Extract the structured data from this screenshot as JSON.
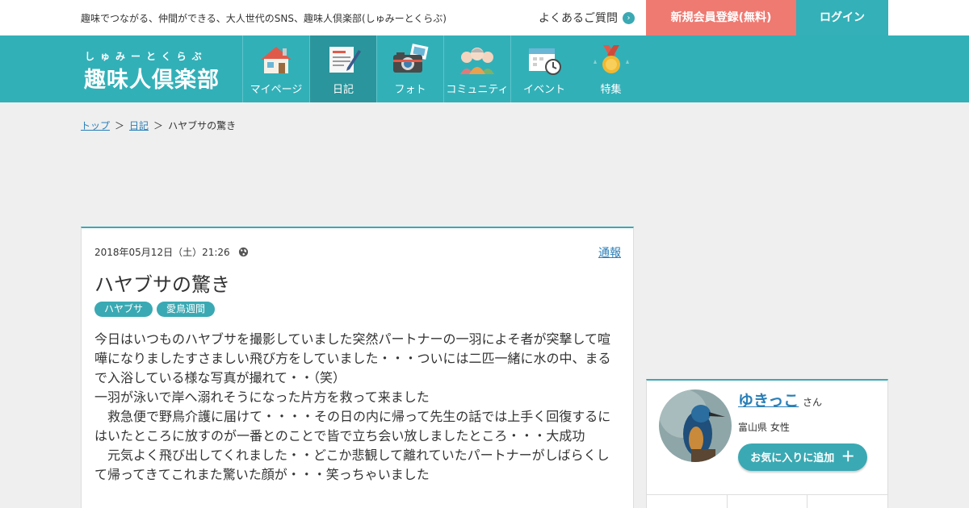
{
  "header": {
    "tagline": "趣味でつながる、仲間ができる、大人世代のSNS、趣味人倶楽部(しゅみーとくらぶ)",
    "faq_label": "よくあるご質問",
    "register_label": "新規会員登録(無料)",
    "login_label": "ログイン"
  },
  "logo": {
    "ruby": "しゅみーとくらぶ",
    "name": "趣味人倶楽部"
  },
  "nav": {
    "items": [
      {
        "label": "マイページ",
        "icon": "house-icon"
      },
      {
        "label": "日記",
        "icon": "diary-icon"
      },
      {
        "label": "フォト",
        "icon": "camera-icon"
      },
      {
        "label": "コミュニティ",
        "icon": "community-icon"
      },
      {
        "label": "イベント",
        "icon": "calendar-icon"
      },
      {
        "label": "特集",
        "icon": "medal-icon"
      }
    ],
    "active": "日記"
  },
  "breadcrumb": {
    "home": "トップ",
    "diary": "日記",
    "current": "ハヤブサの驚き",
    "separator": "＞"
  },
  "article": {
    "datetime": "2018年05月12日（土）21:26",
    "visibility_icon": "globe-icon",
    "report_label": "通報",
    "title": "ハヤブサの驚き",
    "tags": [
      "ハヤブサ",
      "愛鳥週間"
    ],
    "body": [
      "今日はいつものハヤブサを撮影していました突然パートナーの一羽によそ者が突撃して喧嘩になりましたすさましい飛び方をしていました・・・ついには二匹一緒に水の中、まるで入浴している様な写真が撮れて・・（笑）",
      "一羽が泳いで岸へ溺れそうになった片方を救って来ました",
      "　救急便で野鳥介護に届けて・・・・その日の内に帰って先生の話では上手く回復するにはいたところに放すのが一番とのことで皆で立ち会い放しましたところ・・・大成功",
      "　元気よく飛び出してくれました・・どこか悲観して離れていたパートナーがしばらくして帰ってきてこれまた驚いた顔が・・・笑っちゃいました"
    ]
  },
  "profile": {
    "name": "ゆきっこ",
    "honorific": "さん",
    "info": "富山県 女性",
    "fav_label": "お気に入りに追加",
    "fav_icon": "plus-icon"
  },
  "colors": {
    "brand": "#32b0b8",
    "nav_active": "#2a959c",
    "register": "#ee7a72",
    "link": "#2a7fb8"
  }
}
